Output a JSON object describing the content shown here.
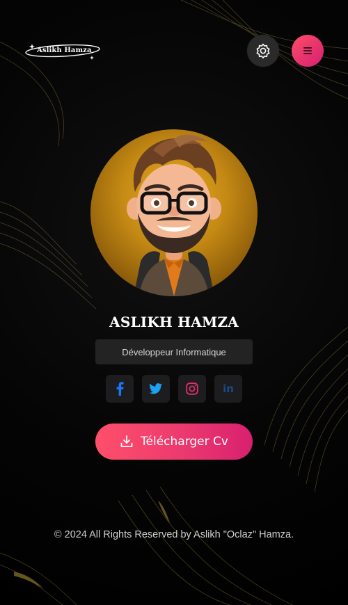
{
  "header": {
    "logo_text": "Aslikh Hamza",
    "theme_toggle_icon": "gear-icon",
    "menu_icon": "hamburger-icon"
  },
  "profile": {
    "name": "ASLIKH HAMZA",
    "role": "Développeur Informatique",
    "avatar_alt": "avatar"
  },
  "social": [
    {
      "name": "facebook",
      "icon": "facebook-icon",
      "color": "#1877F2"
    },
    {
      "name": "twitter",
      "icon": "twitter-icon",
      "color": "#1DA1F2"
    },
    {
      "name": "instagram",
      "icon": "instagram-icon",
      "color": "#E1306C"
    },
    {
      "name": "linkedin",
      "icon": "linkedin-icon",
      "color": "#1C4A86",
      "label": "in"
    }
  ],
  "cta": {
    "label": "Télécharger Cv",
    "icon": "download-icon"
  },
  "footer": {
    "text": "© 2024 All Rights Reserved by Aslikh \"Oclaz\" Hamza."
  },
  "colors": {
    "accent_start": "#FF4F6A",
    "accent_end": "#D8206F",
    "background": "#000000",
    "panel": "#232323"
  }
}
